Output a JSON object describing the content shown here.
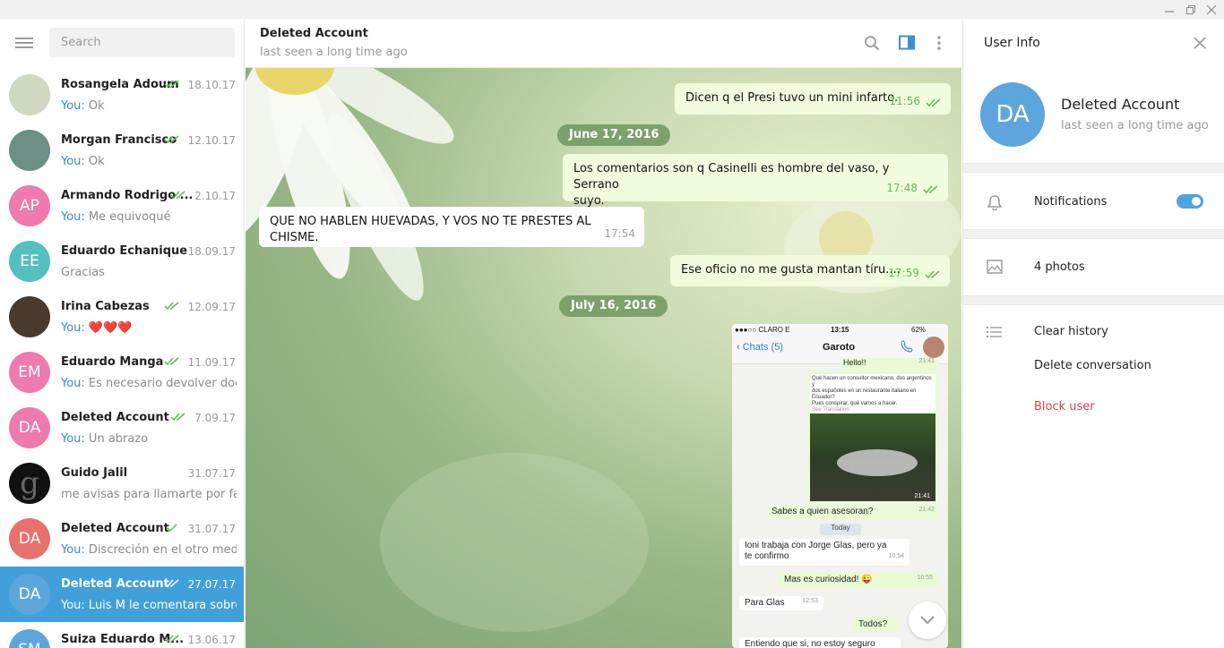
{
  "search": {
    "placeholder": "Search"
  },
  "chats": [
    {
      "name": "Rosangela Adoum",
      "date": "18.10.17",
      "you": "You:",
      "preview": " Ok",
      "initials": "",
      "color": "#cfd8c0",
      "checks": 2
    },
    {
      "name": "Morgan Francisco",
      "date": "12.10.17",
      "you": "You:",
      "preview": " Ok",
      "initials": "",
      "color": "#6c8f86",
      "checks": 2
    },
    {
      "name": "Armando Rodrigo ...",
      "date": "2.10.17",
      "you": "You:",
      "preview": " Me equivoqué",
      "initials": "AP",
      "color": "#ee7aae",
      "checks": 2
    },
    {
      "name": "Eduardo Echanique",
      "date": "18.09.17",
      "you": "",
      "preview": "Gracias",
      "initials": "EE",
      "color": "#55bfbf",
      "checks": 0
    },
    {
      "name": "Irina Cabezas",
      "date": "12.09.17",
      "you": "You:",
      "preview": " ❤️❤️❤️",
      "initials": "",
      "color": "#4a3a2e",
      "checks": 2
    },
    {
      "name": "Eduardo Manga",
      "date": "11.09.17",
      "you": "You:",
      "preview": " Es necesario devolver doc...",
      "initials": "EM",
      "color": "#ee7aae",
      "checks": 2
    },
    {
      "name": "Deleted Account",
      "date": "7.09.17",
      "you": "You:",
      "preview": " Un abrazo",
      "initials": "DA",
      "color": "#ee7aae",
      "checks": 2
    },
    {
      "name": "Guido Jalil",
      "date": "31.07.17",
      "you": "",
      "preview": "me avisas para llamarte por fa",
      "initials": "g",
      "color": "#111111",
      "checks": 0
    },
    {
      "name": "Deleted Account",
      "date": "31.07.17",
      "you": "You:",
      "preview": " Discreción en el otro medio.",
      "initials": "DA",
      "color": "#e6716d",
      "checks": 1
    },
    {
      "name": "Deleted Account",
      "date": "27.07.17",
      "you": "You:",
      "preview": " Luis M le comentara sobre...",
      "initials": "DA",
      "color": "#5ca6dc",
      "checks": 2
    },
    {
      "name": "Suiza Eduardo M...",
      "date": "13.06.17",
      "you": "",
      "preview": "",
      "initials": "SM",
      "color": "#5ca6dc",
      "checks": 2
    }
  ],
  "header": {
    "name": "Deleted Account",
    "status": "last seen a long time ago"
  },
  "messages": [
    {
      "text": "Dicen q el Presi tuvo un mini infarto.",
      "time": "11:56"
    },
    {
      "date": "June 17, 2016"
    },
    {
      "text1": "Los comentarios son q Casinelli  es hombre del vaso, y Serrano",
      "text2": "suyo.",
      "time": "17:48"
    },
    {
      "text": "QUE NO HABLEN HUEVADAS, Y VOS NO TE PRESTES AL CHISME.",
      "time": "17:54"
    },
    {
      "text": "Ese oficio no me gusta mantan tíru....",
      "time": "17:59"
    },
    {
      "date": "July 16, 2016"
    }
  ],
  "shot": {
    "carrier": "●●●○○ CLARO  E",
    "clock": "13:15",
    "battery": "62%",
    "back": "Chats (5)",
    "contact": "Garoto",
    "hello": "Hello!!",
    "hello_time": "21:41",
    "fwd_line1": "Qué hacen un consultor mexicano, dos argentinos y",
    "fwd_line2": "dos españoles en un restaurante italiano en Ecuador?",
    "fwd_line3": "Pues conspirar, qué vamos a hacer.",
    "see_translation": "See Translation",
    "photo_time": "21:41",
    "sabes": "Sabes a quien asesoran?",
    "sabes_time": "21:42",
    "today": "Today",
    "ioni1": "Ioni trabaja con Jorge Glas, pero ya",
    "ioni2": "te confirmo",
    "ioni_time": "10:54",
    "curiosidad": "Mas es curiosidad! 😜",
    "cur_time": "10:55",
    "paraglas": "Para Glas",
    "pg_time": "12:53",
    "todos": "Todos?",
    "entiendo": "Entiendo que si, no estoy seguro"
  },
  "info": {
    "title": "User Info",
    "initials": "DA",
    "name": "Deleted Account",
    "status": "last seen a long time ago",
    "notifications": "Notifications",
    "photos": "4 photos",
    "clear": "Clear history",
    "delete": "Delete conversation",
    "block": "Block user"
  }
}
